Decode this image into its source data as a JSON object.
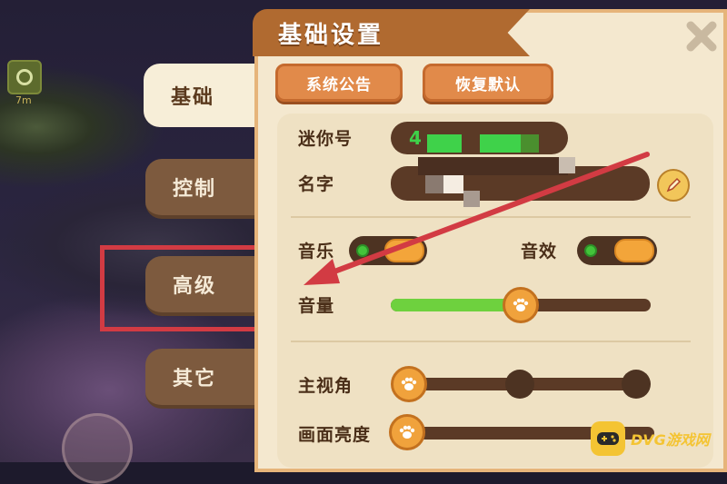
{
  "hud": {
    "distance": "7m"
  },
  "panel": {
    "title": "基础设置",
    "buttons": {
      "announcement": "系统公告",
      "restore_default": "恢复默认"
    }
  },
  "tabs": [
    {
      "label": "基础",
      "active": true
    },
    {
      "label": "控制",
      "active": false
    },
    {
      "label": "高级",
      "active": false
    },
    {
      "label": "其它",
      "active": false
    }
  ],
  "settings": {
    "mini_id": {
      "label": "迷你号",
      "value_visible": "4"
    },
    "name": {
      "label": "名字"
    },
    "music": {
      "label": "音乐",
      "on": true
    },
    "sound_fx": {
      "label": "音效",
      "on": true
    },
    "volume": {
      "label": "音量",
      "level": 0.5
    },
    "view_angle": {
      "label": "主视角",
      "selected_index": 0,
      "stops": 3
    },
    "brightness": {
      "label": "画面亮度"
    }
  },
  "colors": {
    "accent": "#e18a4a",
    "annotation": "#d23b43",
    "slider_fill": "#6ed13e"
  },
  "watermark": {
    "text": "DVG游戏网"
  }
}
